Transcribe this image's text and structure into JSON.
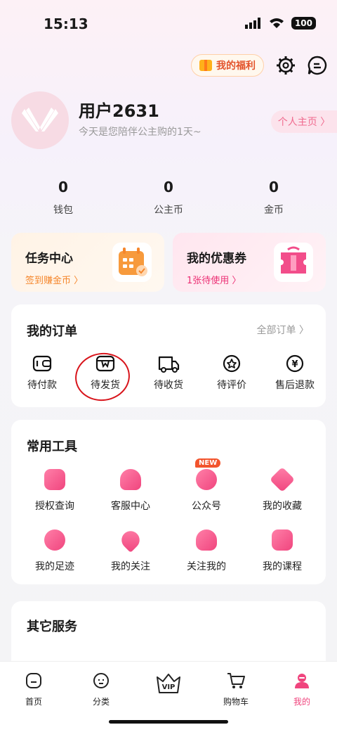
{
  "status_bar": {
    "time": "15:13",
    "battery": "100"
  },
  "header": {
    "welfare_label": "我的福利"
  },
  "profile": {
    "username": "用户2631",
    "subtitle": "今天是您陪伴公主购的1天~",
    "homepage_label": "个人主页 〉"
  },
  "stats": [
    {
      "value": "0",
      "label": "钱包"
    },
    {
      "value": "0",
      "label": "公主币"
    },
    {
      "value": "0",
      "label": "金币"
    }
  ],
  "promos": {
    "task": {
      "title": "任务中心",
      "subtitle": "签到赚金币 〉",
      "color": "#f5862b"
    },
    "coupon": {
      "title": "我的优惠券",
      "subtitle": "1张待使用 〉",
      "color": "#ec2f74"
    }
  },
  "orders": {
    "title": "我的订单",
    "all_label": "全部订单 〉",
    "items": [
      {
        "label": "待付款",
        "icon": "wallet-icon"
      },
      {
        "label": "待发货",
        "icon": "package-icon"
      },
      {
        "label": "待收货",
        "icon": "truck-icon"
      },
      {
        "label": "待评价",
        "icon": "star-review-icon"
      },
      {
        "label": "售后退款",
        "icon": "yuan-refund-icon"
      }
    ]
  },
  "tools": {
    "title": "常用工具",
    "new_badge": "NEW",
    "items": [
      {
        "label": "授权查询",
        "icon": "shield-search-icon"
      },
      {
        "label": "客服中心",
        "icon": "headset-icon"
      },
      {
        "label": "公众号",
        "icon": "chat-bubbles-icon"
      },
      {
        "label": "我的收藏",
        "icon": "star-icon"
      },
      {
        "label": "我的足迹",
        "icon": "footprint-icon"
      },
      {
        "label": "我的关注",
        "icon": "heart-icon"
      },
      {
        "label": "关注我的",
        "icon": "users-icon"
      },
      {
        "label": "我的课程",
        "icon": "course-icon"
      }
    ]
  },
  "other": {
    "title": "其它服务"
  },
  "tabbar": [
    {
      "label": "首页",
      "icon": "home-icon"
    },
    {
      "label": "分类",
      "icon": "category-icon"
    },
    {
      "label": "VIP",
      "icon": "vip-crown-icon"
    },
    {
      "label": "购物车",
      "icon": "cart-icon"
    },
    {
      "label": "我的",
      "icon": "me-icon",
      "active": true
    }
  ],
  "colors": {
    "accent": "#f0457e",
    "orange": "#f5862b",
    "annotation": "#d8141b"
  }
}
